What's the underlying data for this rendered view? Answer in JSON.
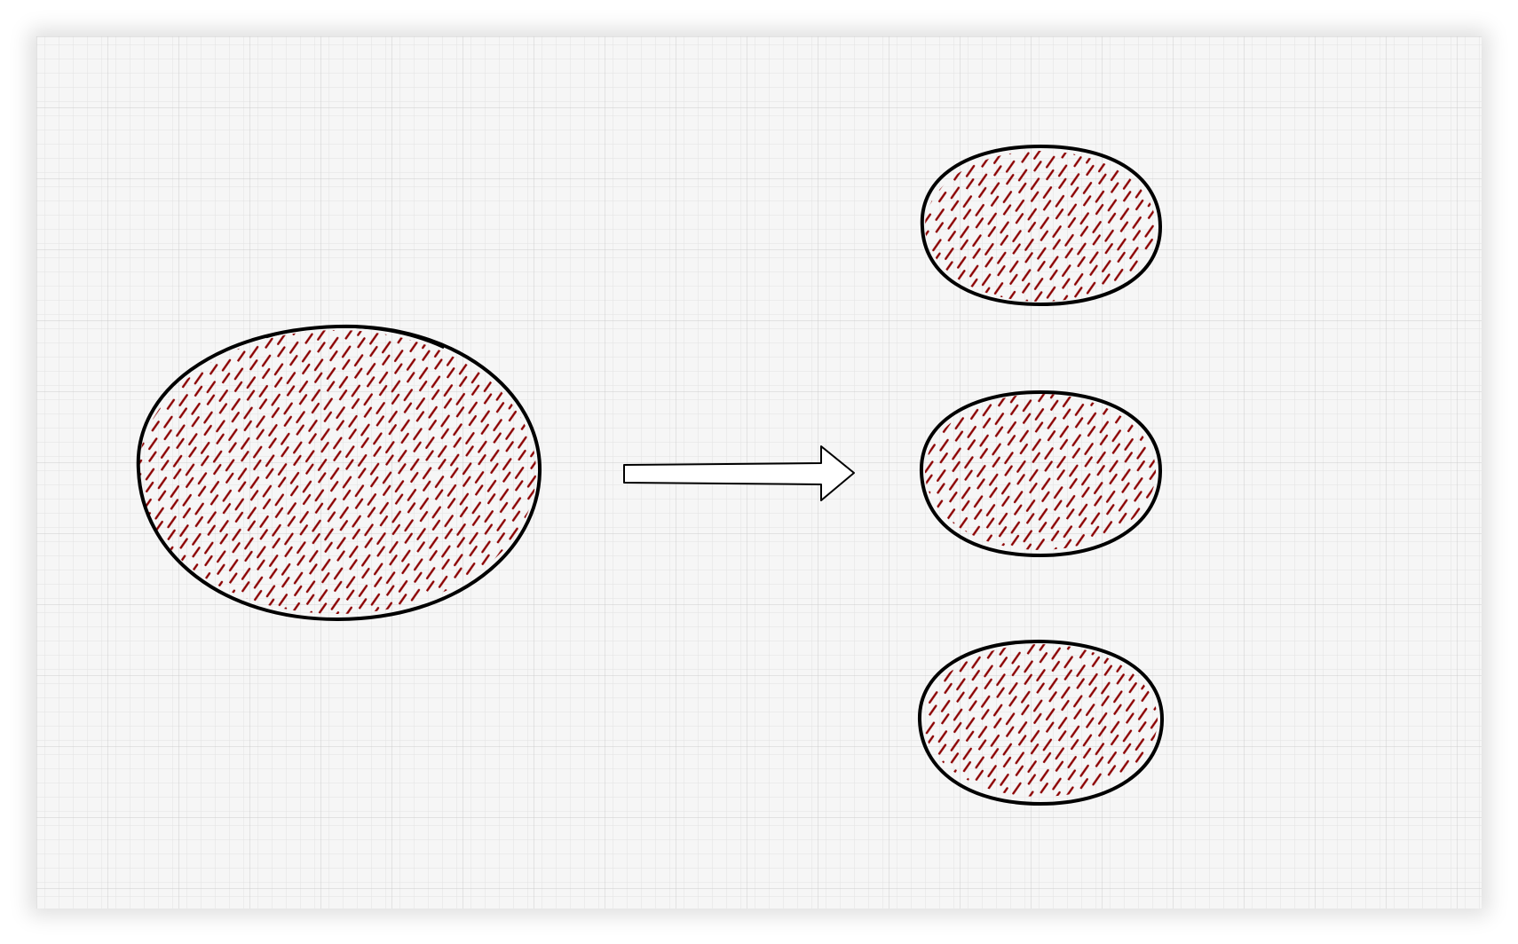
{
  "canvas": {
    "background": "#f6f6f6",
    "grid": true,
    "grid_color_minor": "#e2e2e2",
    "grid_color_major": "#cdcdcd"
  },
  "diagram": {
    "shapes": [
      {
        "name": "source-ellipse",
        "kind": "ellipse",
        "fill": "hachure",
        "fill_color": "#8b0000",
        "stroke_color": "#000000"
      },
      {
        "name": "target-ellipse-top",
        "kind": "ellipse",
        "fill": "hachure",
        "fill_color": "#8b0000",
        "stroke_color": "#000000"
      },
      {
        "name": "target-ellipse-middle",
        "kind": "ellipse",
        "fill": "hachure",
        "fill_color": "#8b0000",
        "stroke_color": "#000000"
      },
      {
        "name": "target-ellipse-bottom",
        "kind": "ellipse",
        "fill": "hachure",
        "fill_color": "#8b0000",
        "stroke_color": "#000000"
      }
    ],
    "connectors": [
      {
        "name": "split-arrow",
        "kind": "block-arrow",
        "direction": "right",
        "from": "source-ellipse",
        "to": "target-ellipses",
        "fill_color": "#ffffff",
        "stroke_color": "#000000"
      }
    ]
  }
}
